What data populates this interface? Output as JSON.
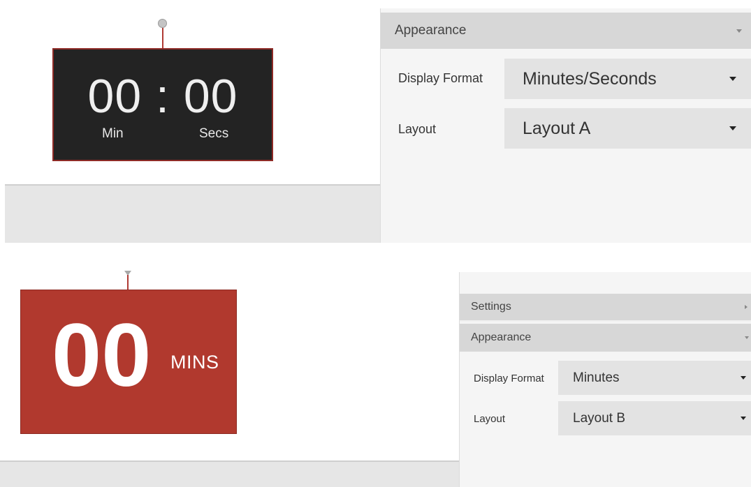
{
  "top": {
    "widget": {
      "minutes": "00",
      "separator": ":",
      "seconds": "00",
      "min_label": "Min",
      "secs_label": "Secs"
    },
    "panel": {
      "section_title": "Appearance",
      "rows": [
        {
          "label": "Display Format",
          "value": "Minutes/Seconds"
        },
        {
          "label": "Layout",
          "value": "Layout A"
        }
      ]
    }
  },
  "bottom": {
    "widget": {
      "value": "00",
      "unit": "MINS"
    },
    "panel": {
      "settings_title": "Settings",
      "section_title": "Appearance",
      "rows": [
        {
          "label": "Display Format",
          "value": "Minutes"
        },
        {
          "label": "Layout",
          "value": "Layout B"
        }
      ]
    }
  },
  "colors": {
    "widget_a_bg": "#232323",
    "widget_b_bg": "#b1392e",
    "accent_red": "#8e2a26"
  }
}
